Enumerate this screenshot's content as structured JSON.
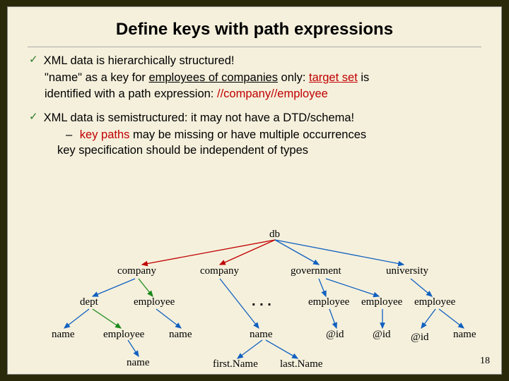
{
  "title": "Define keys with path expressions",
  "bullets": {
    "b1": "XML data is hierarchically structured!",
    "line2a": "\"name\" as a key for ",
    "line2u": "employees of companies",
    "line2b": " only:  ",
    "line2c": "target set",
    "line2d": " is",
    "line3a": "identified with a path expression: ",
    "line3b": "//company//employee",
    "b2": "XML data is semistructured: it may not have a DTD/schema!",
    "sub1a": "key paths",
    "sub1b": " may be missing or have multiple occurrences",
    "sub2": "key specification should be independent of types"
  },
  "tree": {
    "db": "db",
    "company": "company",
    "government": "government",
    "university": "university",
    "dept": "dept",
    "employee": "employee",
    "name": "name",
    "atid": "@id",
    "firstName": "first.Name",
    "lastName": "last.Name",
    "dots": ". . ."
  },
  "pagenum": "18"
}
